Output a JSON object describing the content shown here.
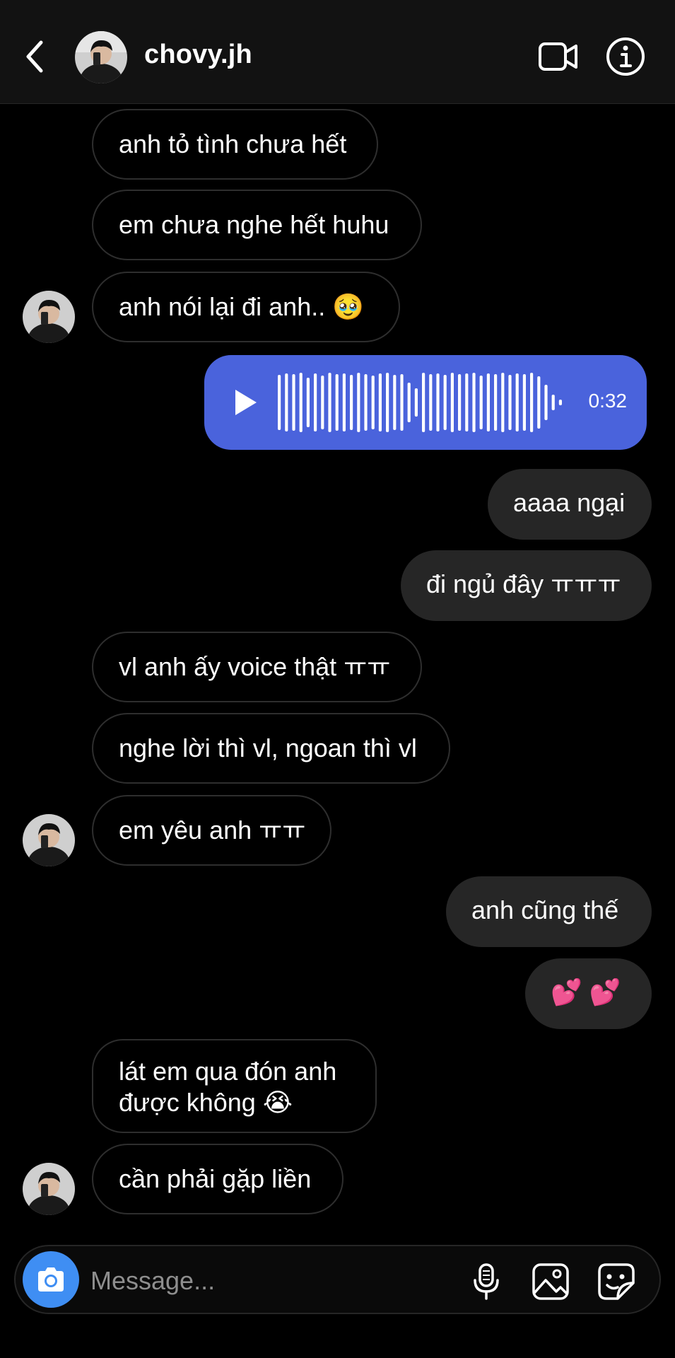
{
  "header": {
    "username": "chovy.jh"
  },
  "messages": [
    {
      "text": "anh tỏ tình chưa hết"
    },
    {
      "text": "em chưa nghe hết huhu"
    },
    {
      "text": "anh nói lại đi anh.. 🥹"
    },
    {
      "duration": "0:32"
    },
    {
      "text": "aaaa ngại"
    },
    {
      "text": "đi ngủ đây ㅠㅠㅠ"
    },
    {
      "text": "vl anh ấy voice thật ㅠㅠ"
    },
    {
      "text": "nghe lời thì vl, ngoan thì vl"
    },
    {
      "text": "em yêu anh ㅠㅠ"
    },
    {
      "text": "anh cũng thế"
    },
    {
      "text": "💕 💕"
    },
    {
      "text": "lát em qua đón anh được không 😭"
    },
    {
      "text": "cần phải gặp liền"
    }
  ],
  "composer": {
    "placeholder": "Message..."
  },
  "colors": {
    "background": "#000000",
    "header": "#121212",
    "incoming_border": "#2e2e2e",
    "outgoing_bubble": "#262626",
    "voice_bubble": "#4a63dc",
    "camera_button": "#3f8ef3"
  },
  "icons": {
    "back": "chevron-left-icon",
    "video": "video-camera-icon",
    "info": "info-icon",
    "play": "play-icon",
    "camera": "camera-icon",
    "mic": "microphone-icon",
    "gallery": "image-icon",
    "sticker": "sticker-icon"
  }
}
